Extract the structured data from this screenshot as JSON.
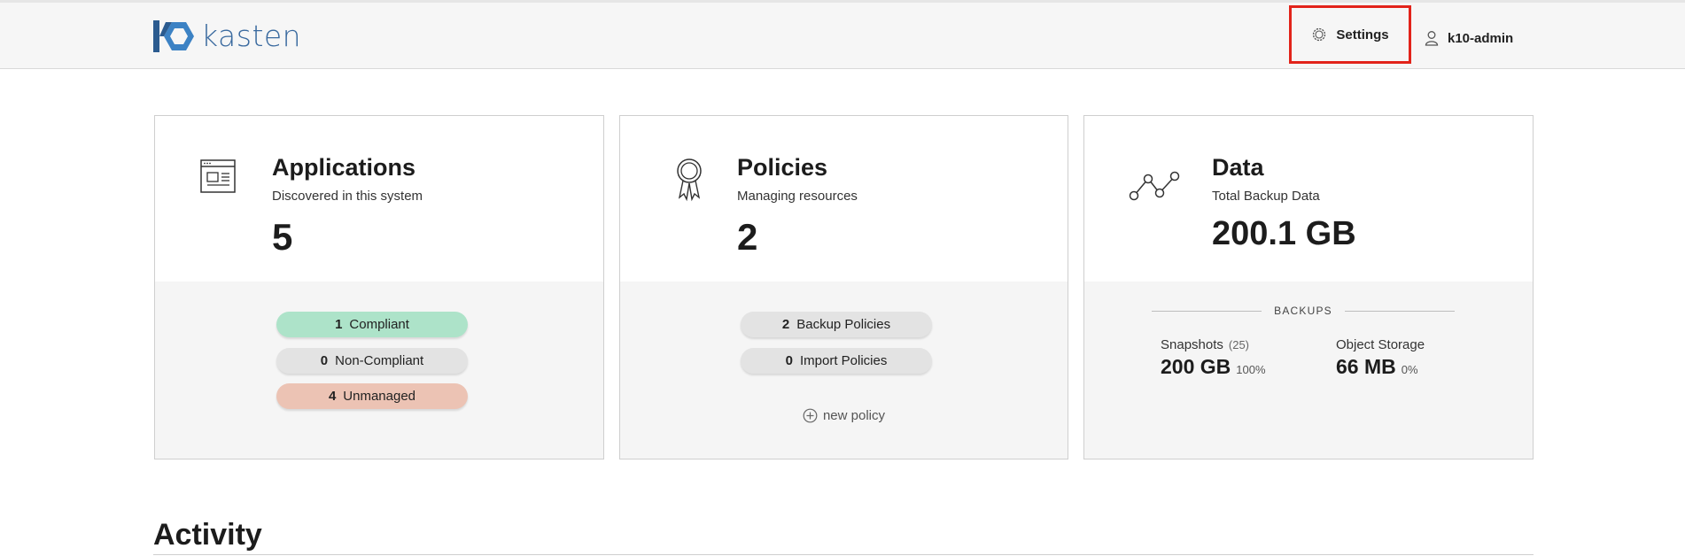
{
  "header": {
    "logo_text": "kasten",
    "settings_label": "Settings",
    "user_label": "k10-admin"
  },
  "cards": {
    "applications": {
      "title": "Applications",
      "subtitle": "Discovered in this system",
      "count": "5",
      "pills": [
        {
          "count": "1",
          "label": "Compliant",
          "color": "#ade3c9"
        },
        {
          "count": "0",
          "label": "Non-Compliant",
          "color": "#e3e3e3"
        },
        {
          "count": "4",
          "label": "Unmanaged",
          "color": "#ecc3b4"
        }
      ]
    },
    "policies": {
      "title": "Policies",
      "subtitle": "Managing resources",
      "count": "2",
      "pills": [
        {
          "count": "2",
          "label": "Backup Policies"
        },
        {
          "count": "0",
          "label": "Import Policies"
        }
      ],
      "new_policy_label": "new policy"
    },
    "data": {
      "title": "Data",
      "subtitle": "Total Backup Data",
      "total": "200.1 GB",
      "backups_label": "BACKUPS",
      "snapshots": {
        "label": "Snapshots",
        "count": "(25)",
        "value": "200 GB",
        "percent": "100%"
      },
      "object_storage": {
        "label": "Object Storage",
        "value": "66 MB",
        "percent": "0%"
      }
    }
  },
  "activity_title": "Activity",
  "colors": {
    "highlight": "#e2231a",
    "logo": "#3a6a9f"
  }
}
